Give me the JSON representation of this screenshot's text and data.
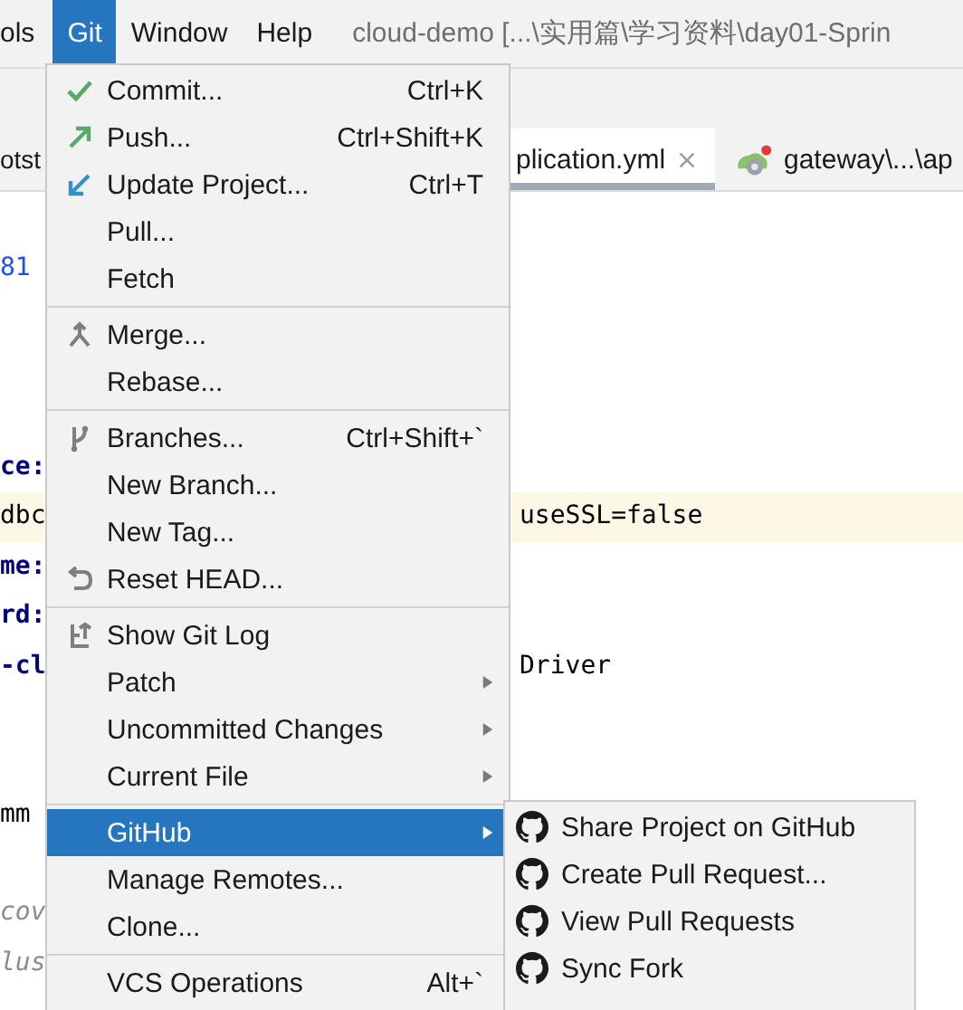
{
  "menu_bar": [
    {
      "label": "ols",
      "selected": false
    },
    {
      "label": "Git",
      "selected": true
    },
    {
      "label": "Window",
      "selected": false
    },
    {
      "label": "Help",
      "selected": false
    }
  ],
  "window": {
    "title": "cloud-demo [...\\实用篇\\学习资料\\day01-Sprin"
  },
  "tabs": [
    {
      "label": "otst",
      "selected": false
    },
    {
      "label": "plication.yml",
      "selected": true,
      "closable": true
    },
    {
      "label": "gateway\\...\\ap",
      "selected": false
    }
  ],
  "editor": {
    "lines": [
      {
        "highlighted": false
      },
      {
        "left": {
          "text": "81",
          "kind": "number"
        },
        "highlighted": false
      },
      {
        "highlighted": false
      },
      {
        "highlighted": false
      },
      {
        "highlighted": false
      },
      {
        "left": {
          "text": "ce:",
          "kind": "key"
        },
        "highlighted": false
      },
      {
        "left": {
          "text": "dbc",
          "kind": "value"
        },
        "right": "useSSL=false",
        "highlighted": true
      },
      {
        "left": {
          "text": "me:",
          "kind": "key"
        },
        "highlighted": false
      },
      {
        "left": {
          "text": "rd:",
          "kind": "key"
        },
        "highlighted": false
      },
      {
        "left": {
          "text": "-cl",
          "kind": "key"
        },
        "right": "Driver",
        "highlighted": false
      },
      {
        "highlighted": false
      },
      {
        "highlighted": false
      },
      {
        "left": {
          "text": "mm",
          "kind": "value"
        },
        "highlighted": false
      },
      {
        "highlighted": false
      },
      {
        "left": {
          "text": "cov",
          "kind": "comment"
        },
        "highlighted": false
      },
      {
        "left": {
          "text": "lus",
          "kind": "comment"
        },
        "highlighted": false
      }
    ]
  },
  "git_menu": {
    "groups": [
      [
        {
          "label": "Commit...",
          "shortcut": "Ctrl+K",
          "submenu": false,
          "selected": false
        },
        {
          "label": "Push...",
          "shortcut": "Ctrl+Shift+K",
          "submenu": false,
          "selected": false
        },
        {
          "label": "Update Project...",
          "shortcut": "Ctrl+T",
          "submenu": false,
          "selected": false
        },
        {
          "label": "Pull...",
          "submenu": false,
          "selected": false
        },
        {
          "label": "Fetch",
          "submenu": false,
          "selected": false
        }
      ],
      [
        {
          "label": "Merge...",
          "submenu": false,
          "selected": false
        },
        {
          "label": "Rebase...",
          "submenu": false,
          "selected": false
        }
      ],
      [
        {
          "label": "Branches...",
          "shortcut": "Ctrl+Shift+`",
          "submenu": false,
          "selected": false
        },
        {
          "label": "New Branch...",
          "submenu": false,
          "selected": false
        },
        {
          "label": "New Tag...",
          "submenu": false,
          "selected": false
        },
        {
          "label": "Reset HEAD...",
          "submenu": false,
          "selected": false
        }
      ],
      [
        {
          "label": "Show Git Log",
          "submenu": false,
          "selected": false
        },
        {
          "label": "Patch",
          "submenu": true,
          "selected": false
        },
        {
          "label": "Uncommitted Changes",
          "submenu": true,
          "selected": false
        },
        {
          "label": "Current File",
          "submenu": true,
          "selected": false
        }
      ],
      [
        {
          "label": "GitHub",
          "submenu": true,
          "selected": true
        },
        {
          "label": "Manage Remotes...",
          "submenu": false,
          "selected": false
        },
        {
          "label": "Clone...",
          "submenu": false,
          "selected": false
        }
      ],
      [
        {
          "label": "VCS Operations",
          "shortcut": "Alt+`",
          "submenu": false,
          "selected": false
        }
      ]
    ]
  },
  "github_submenu": {
    "items": [
      {
        "label": "Share Project on GitHub",
        "selected": false
      },
      {
        "label": "Create Pull Request...",
        "selected": false
      },
      {
        "label": "View Pull Requests",
        "selected": false
      },
      {
        "label": "Sync Fork",
        "selected": false
      }
    ]
  }
}
